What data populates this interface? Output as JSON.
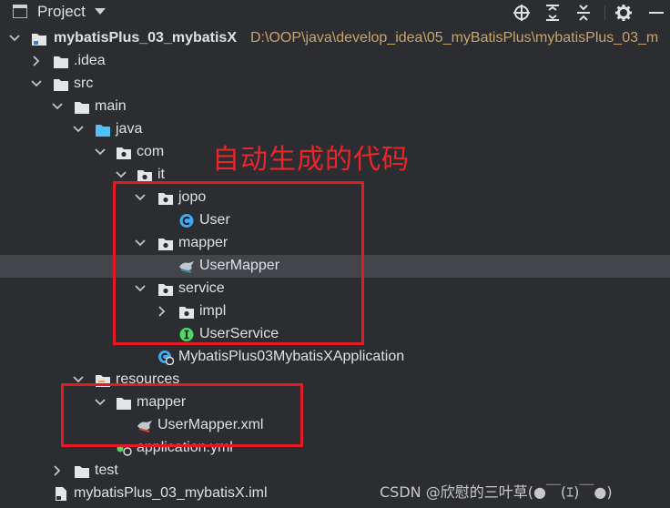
{
  "header": {
    "title": "Project",
    "buttons": [
      "crosshair-icon",
      "expand-all-icon",
      "collapse-all-icon",
      "gear-icon",
      "minimize-icon"
    ]
  },
  "tree": {
    "root_name": "mybatisPlus_03_mybatisX",
    "root_path": "D:\\OOP\\java\\develop_idea\\05_myBatisPlus\\mybatisPlus_03_m",
    "idea": ".idea",
    "src": "src",
    "main": "main",
    "java": "java",
    "com": "com",
    "it": "it",
    "jopo": "jopo",
    "user": "User",
    "mapper": "mapper",
    "user_mapper": "UserMapper",
    "service": "service",
    "impl": "impl",
    "user_service": "UserService",
    "application_class": "MybatisPlus03MybatisXApplication",
    "resources": "resources",
    "res_mapper": "mapper",
    "user_mapper_xml": "UserMapper.xml",
    "application_yml": "application.yml",
    "test": "test",
    "iml": "mybatisPlus_03_mybatisX.iml"
  },
  "annotation": {
    "text": "自动生成的代码",
    "color": "#e01b24"
  },
  "watermark": "CSDN @欣慰的三叶草(●￣(ｴ)￣●)",
  "colors": {
    "background": "#2b2d30",
    "selected_row": "#43454a",
    "path_text": "#c9a46d",
    "folder_src": "#4fc3f7",
    "class_icon": "#3fa9f5",
    "interface_icon": "#4cd964"
  }
}
